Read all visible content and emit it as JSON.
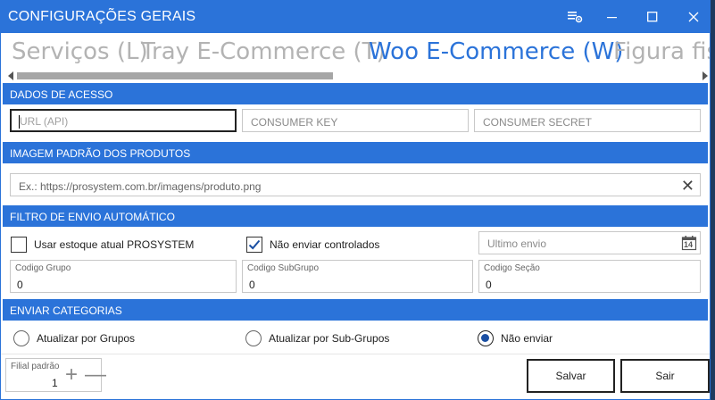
{
  "window": {
    "title": "CONFIGURAÇÕES GERAIS"
  },
  "titlebar_buttons": {
    "icons": [
      "settings-icon",
      "minimize-icon",
      "maximize-icon",
      "close-icon"
    ]
  },
  "tabs": [
    {
      "label": "Serviços (L)",
      "active": false
    },
    {
      "label": "Tray E-Commerce (T)",
      "active": false
    },
    {
      "label": "Woo E-Commerce (W)",
      "active": true
    },
    {
      "label": "Figura fis",
      "active": false
    }
  ],
  "sections": {
    "access": "DADOS DE ACESSO",
    "image": "IMAGEM PADRÃO DOS PRODUTOS",
    "filter": "FILTRO DE ENVIO AUTOMÁTICO",
    "categories": "ENVIAR CATEGORIAS"
  },
  "access": {
    "url_placeholder": "URL (API)",
    "consumer_key_placeholder": "CONSUMER KEY",
    "consumer_secret_placeholder": "CONSUMER SECRET"
  },
  "image": {
    "placeholder": "Ex.: https://prosystem.com.br/imagens/produto.png"
  },
  "filter": {
    "use_stock_label": "Usar estoque atual PROSYSTEM",
    "use_stock_checked": false,
    "no_controlled_label": "Não enviar controlados",
    "no_controlled_checked": true,
    "last_send_placeholder": "Ultimo envio",
    "calendar_day": "14",
    "group_label": "Codigo Grupo",
    "group_value": "0",
    "subgroup_label": "Codigo SubGrupo",
    "subgroup_value": "0",
    "section_label": "Codigo Seção",
    "section_value": "0"
  },
  "categories": {
    "options": [
      {
        "label": "Atualizar por Grupos",
        "selected": false
      },
      {
        "label": "Atualizar por Sub-Grupos",
        "selected": false
      },
      {
        "label": "Não enviar",
        "selected": true
      }
    ]
  },
  "footer": {
    "branch_label": "Filial padrão",
    "branch_value": "1",
    "plus": "+",
    "minus": "—",
    "save_label": "Salvar",
    "exit_label": "Sair"
  },
  "colors": {
    "accent": "#2b73d9",
    "background": "#ffffff"
  }
}
